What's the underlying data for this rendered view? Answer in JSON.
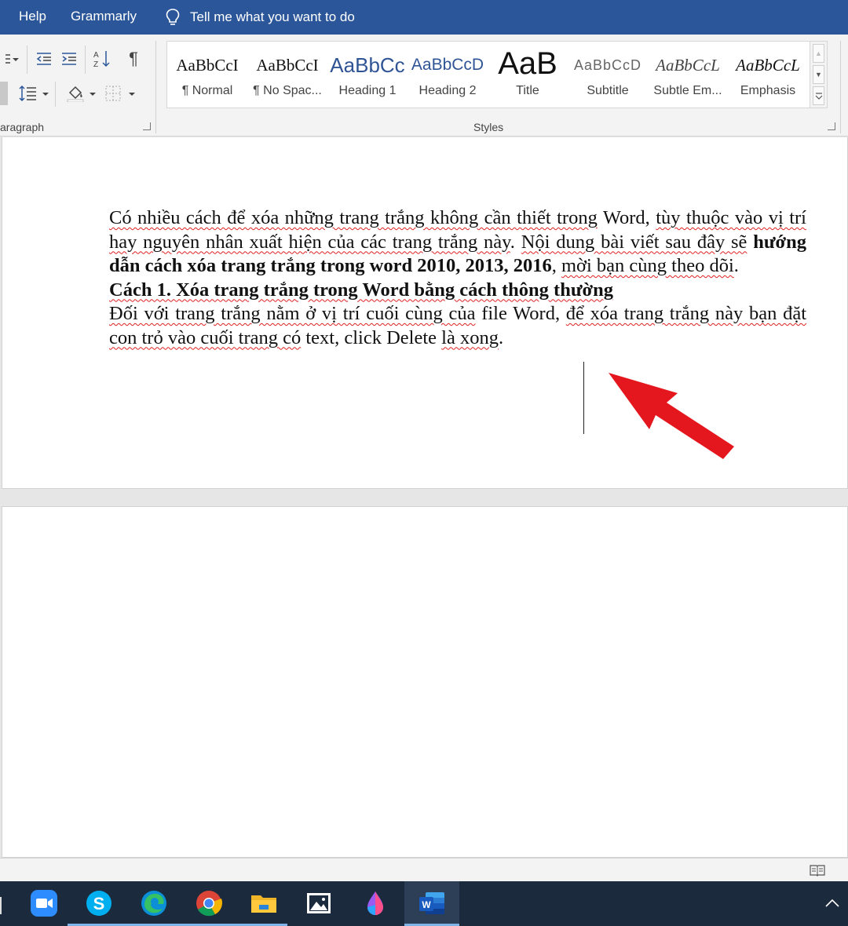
{
  "tabs": {
    "help": "Help",
    "grammarly": "Grammarly",
    "tell_me": "Tell me what you want to do"
  },
  "ribbon": {
    "paragraph_label": "aragraph",
    "styles_label": "Styles",
    "styles": [
      {
        "sample": "AaBbCcI",
        "name": "¶ Normal"
      },
      {
        "sample": "AaBbCcI",
        "name": "¶ No Spac..."
      },
      {
        "sample": "AaBbCc",
        "name": "Heading 1"
      },
      {
        "sample": "AaBbCcD",
        "name": "Heading 2"
      },
      {
        "sample": "AaB",
        "name": "Title"
      },
      {
        "sample": "AaBbCcD",
        "name": "Subtitle"
      },
      {
        "sample": "AaBbCcL",
        "name": "Subtle Em..."
      },
      {
        "sample": "AaBbCcL",
        "name": "Emphasis"
      }
    ]
  },
  "document": {
    "p1": {
      "s1": "Có nhiều cách để xóa những trang trắng không cần thiết trong",
      "s2": " Word, ",
      "s3": "tùy thuộc vào vị trí hay nguyên nhân xuất hiện của các trang trắng này",
      "s4": ". ",
      "s5": "Nội dung bài viết sau đây sẽ",
      "s6": " hướng dẫn cách xóa trang trắng trong word 2010, 2013, 2016",
      "s7": ", ",
      "s8": "mời bạn cùng theo dõi",
      "s9": "."
    },
    "heading": "Cách 1. Xóa trang trắng trong Word bằng cách thông thường",
    "p2": {
      "s1": "Đối với trang trắng nằm ở vị trí cuối cùng của",
      "s2": " file Word, ",
      "s3": "để xóa trang trắng này bạn đặt con trỏ vào cuối trang có",
      "s4": " text, click Delete ",
      "s5": "là xong",
      "s6": "."
    }
  },
  "icons": {
    "lightbulb": "lightbulb-icon",
    "arrow": "red-arrow-annotation"
  },
  "colors": {
    "titlebar": "#2b579a",
    "arrow": "#e3171d",
    "taskbar": "#1b2a3d"
  }
}
